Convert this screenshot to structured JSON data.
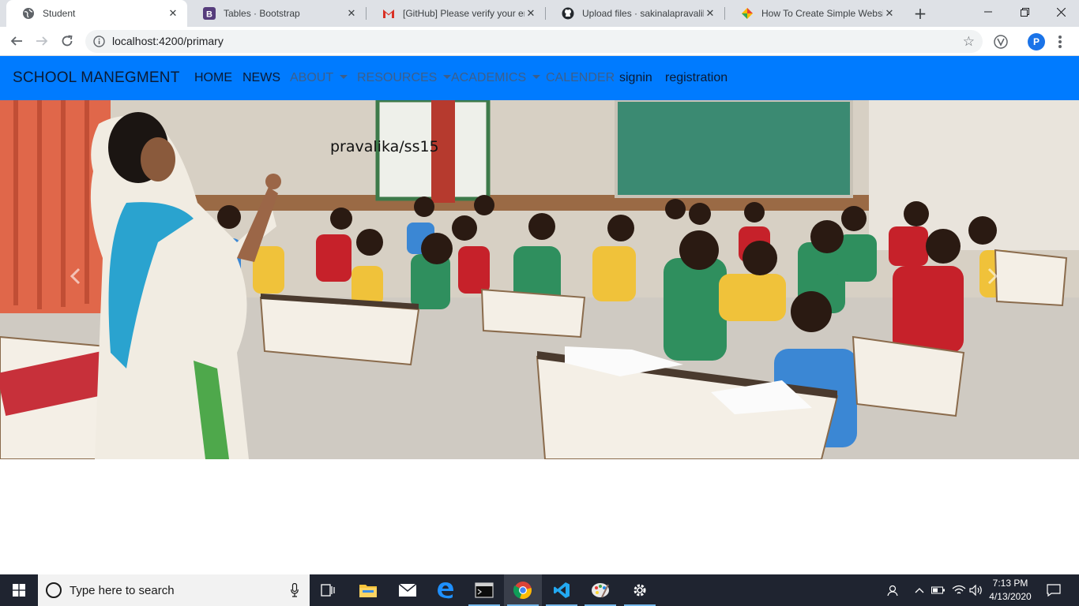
{
  "browser": {
    "tabs": [
      {
        "title": "Student",
        "icon": "globe-icon",
        "active": true
      },
      {
        "title": "Tables · Bootstrap",
        "icon": "bootstrap-icon",
        "active": false
      },
      {
        "title": "[GitHub] Please verify your em",
        "icon": "gmail-icon",
        "active": false
      },
      {
        "title": "Upload files · sakinalapravalika",
        "icon": "github-icon",
        "active": false
      },
      {
        "title": "How To Create Simple Website",
        "icon": "colorful-icon",
        "active": false
      }
    ],
    "url": "localhost:4200/primary",
    "profile_initial": "P"
  },
  "navbar": {
    "brand": "SCHOOL MANEGMENT",
    "items": [
      {
        "label": "HOME",
        "dropdown": false,
        "muted": false
      },
      {
        "label": "NEWS",
        "dropdown": false,
        "muted": false
      },
      {
        "label": "ABOUT",
        "dropdown": true,
        "muted": true
      },
      {
        "label": "RESOURCES",
        "dropdown": true,
        "muted": true
      },
      {
        "label": "ACADEMICS",
        "dropdown": true,
        "muted": true
      },
      {
        "label": "CALENDER",
        "dropdown": false,
        "muted": true
      },
      {
        "label": "signin",
        "dropdown": false,
        "muted": false
      },
      {
        "label": "registration",
        "dropdown": false,
        "muted": false
      }
    ],
    "color": "#007bff"
  },
  "hero": {
    "caption": "pravalika/ss15",
    "prev_icon": "chevron-left-icon",
    "next_icon": "chevron-right-icon"
  },
  "taskbar": {
    "search_placeholder": "Type here to search",
    "time": "7:13 PM",
    "date": "4/13/2020",
    "apps": [
      "task-view-icon",
      "file-explorer-icon",
      "mail-icon",
      "edge-icon",
      "terminal-icon",
      "chrome-icon",
      "vscode-icon",
      "paint-icon",
      "settings-icon"
    ]
  }
}
